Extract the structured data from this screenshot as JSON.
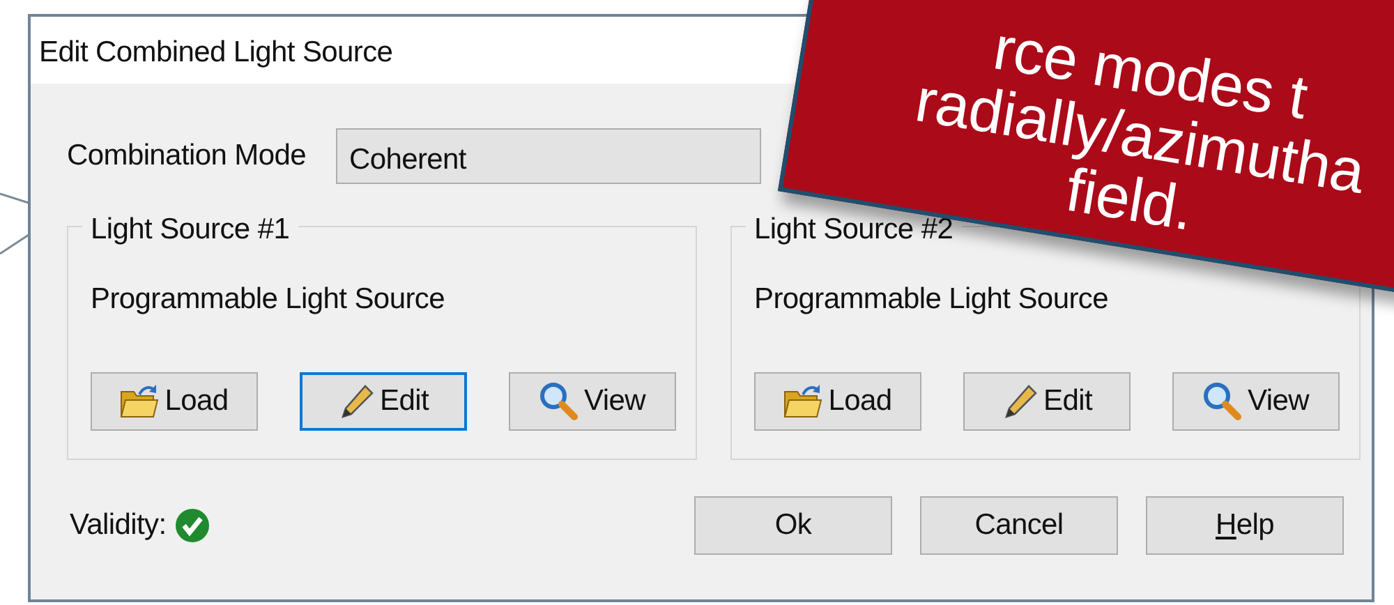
{
  "window": {
    "title": "Edit Combined Light Source"
  },
  "combination_mode": {
    "label": "Combination Mode",
    "value": "Coherent"
  },
  "groups": [
    {
      "title": "Light Source #1",
      "source_name": "Programmable Light Source",
      "buttons": [
        {
          "kind": "load",
          "label": "Load",
          "focused": false
        },
        {
          "kind": "edit",
          "label": "Edit",
          "focused": true
        },
        {
          "kind": "view",
          "label": "View",
          "focused": false
        }
      ]
    },
    {
      "title": "Light Source #2",
      "source_name": "Programmable Light Source",
      "buttons": [
        {
          "kind": "load",
          "label": "Load",
          "focused": false
        },
        {
          "kind": "edit",
          "label": "Edit",
          "focused": false
        },
        {
          "kind": "view",
          "label": "View",
          "focused": false
        }
      ]
    }
  ],
  "validity": {
    "label": "Validity:",
    "valid": true
  },
  "buttons": [
    {
      "label": "Ok",
      "mnemonic_underlined": false
    },
    {
      "label": "Cancel",
      "mnemonic_underlined": false
    },
    {
      "label": "Help",
      "mnemonic_underlined": true
    }
  ],
  "callout": {
    "lines": [
      "rce modes t",
      "radially/azimutha",
      "field."
    ]
  }
}
